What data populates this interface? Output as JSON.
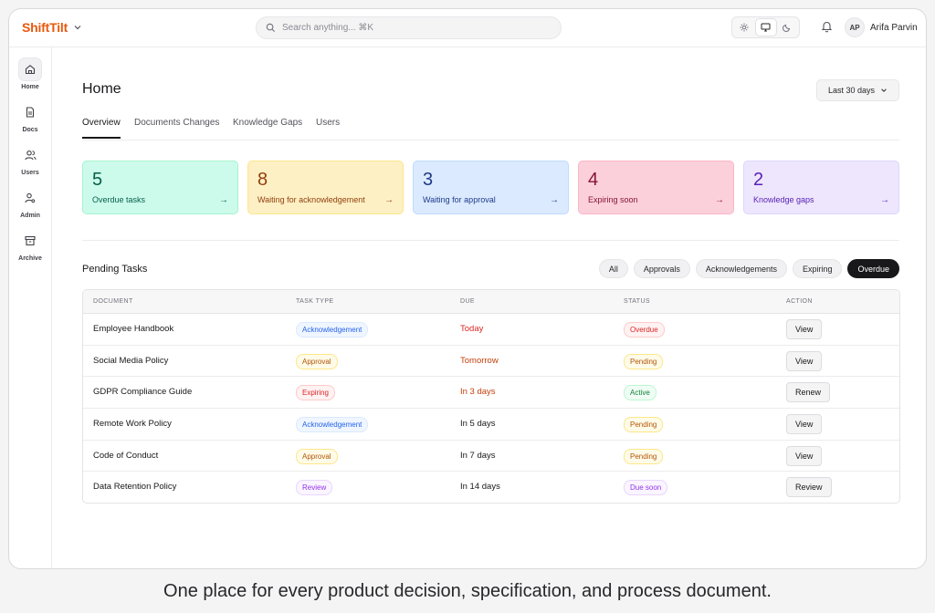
{
  "app": {
    "name": "ShiftTilt"
  },
  "search": {
    "placeholder": "Search anything... ⌘K"
  },
  "user": {
    "initials": "AP",
    "name": "Arifa Parvin"
  },
  "sidebar": {
    "items": [
      {
        "label": "Home",
        "icon": "home-icon",
        "active": true
      },
      {
        "label": "Docs",
        "icon": "document-icon",
        "active": false
      },
      {
        "label": "Users",
        "icon": "users-icon",
        "active": false
      },
      {
        "label": "Admin",
        "icon": "user-cog-icon",
        "active": false
      },
      {
        "label": "Archive",
        "icon": "archive-icon",
        "active": false
      }
    ]
  },
  "page": {
    "title": "Home",
    "range": "Last 30 days"
  },
  "tabs": [
    {
      "label": "Overview",
      "active": true
    },
    {
      "label": "Documents Changes",
      "active": false
    },
    {
      "label": "Knowledge Gaps",
      "active": false
    },
    {
      "label": "Users",
      "active": false
    }
  ],
  "cards": [
    {
      "count": "5",
      "label": "Overdue tasks",
      "bg": "#ccfbec",
      "border": "#a7f3d0",
      "fg": "#065f46"
    },
    {
      "count": "8",
      "label": "Waiting for acknowledgement",
      "bg": "#fdf0c4",
      "border": "#fde68a",
      "fg": "#92400e"
    },
    {
      "count": "3",
      "label": "Waiting for approval",
      "bg": "#dbeafe",
      "border": "#bfdbfe",
      "fg": "#1e3a8a"
    },
    {
      "count": "4",
      "label": "Expiring soon",
      "bg": "#fbd0da",
      "border": "#fbb6c6",
      "fg": "#881337"
    },
    {
      "count": "2",
      "label": "Knowledge gaps",
      "bg": "#ede6fd",
      "border": "#ddd6fe",
      "fg": "#5b21b6"
    }
  ],
  "pending": {
    "title": "Pending Tasks",
    "filters": [
      {
        "label": "All",
        "active": false
      },
      {
        "label": "Approvals",
        "active": false
      },
      {
        "label": "Acknowledgements",
        "active": false
      },
      {
        "label": "Expiring",
        "active": false
      },
      {
        "label": "Overdue",
        "active": true
      }
    ],
    "columns": [
      "Document",
      "Task type",
      "Due",
      "Status",
      "Action"
    ],
    "rows": [
      {
        "document": "Employee Handbook",
        "type": "Acknowledgement",
        "type_tone": "blue",
        "due": "Today",
        "due_tone": "red",
        "status": "Overdue",
        "status_tone": "red",
        "action": "View"
      },
      {
        "document": "Social Media Policy",
        "type": "Approval",
        "type_tone": "amber",
        "due": "Tomorrow",
        "due_tone": "orange",
        "status": "Pending",
        "status_tone": "amber",
        "action": "View"
      },
      {
        "document": "GDPR Compliance Guide",
        "type": "Expiring",
        "type_tone": "red",
        "due": "In 3 days",
        "due_tone": "orange",
        "status": "Active",
        "status_tone": "green",
        "action": "Renew"
      },
      {
        "document": "Remote Work Policy",
        "type": "Acknowledgement",
        "type_tone": "blue",
        "due": "In 5 days",
        "due_tone": "plain",
        "status": "Pending",
        "status_tone": "amber",
        "action": "View"
      },
      {
        "document": "Code of Conduct",
        "type": "Approval",
        "type_tone": "amber",
        "due": "In 7 days",
        "due_tone": "plain",
        "status": "Pending",
        "status_tone": "amber",
        "action": "View"
      },
      {
        "document": "Data Retention Policy",
        "type": "Review",
        "type_tone": "purple",
        "due": "In 14 days",
        "due_tone": "plain",
        "status": "Due soon",
        "status_tone": "purple",
        "action": "Review"
      }
    ]
  },
  "tones": {
    "blue": {
      "bg": "#eff6ff",
      "border": "#dbeafe",
      "fg": "#2563eb"
    },
    "amber": {
      "bg": "#fefce8",
      "border": "#fde68a",
      "fg": "#b45309"
    },
    "red": {
      "bg": "#fef2f2",
      "border": "#fecaca",
      "fg": "#dc2626"
    },
    "green": {
      "bg": "#f0fdf4",
      "border": "#bbf7d0",
      "fg": "#15803d"
    },
    "purple": {
      "bg": "#faf5ff",
      "border": "#e9d5ff",
      "fg": "#9333ea"
    },
    "orange": {
      "fg": "#c2410c"
    },
    "plain": {
      "fg": "#18181b"
    }
  },
  "caption": "One place for every product decision, specification, and process document."
}
